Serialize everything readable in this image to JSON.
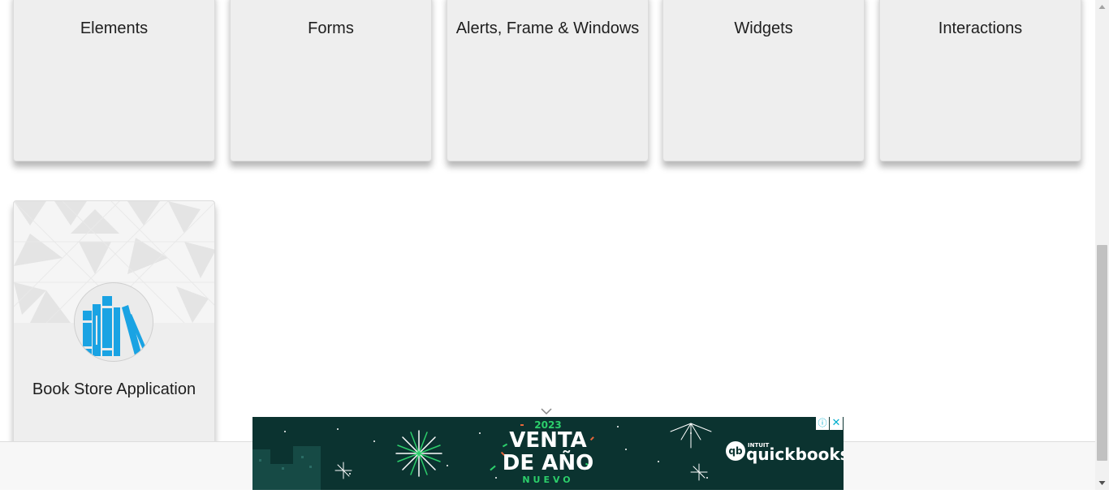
{
  "category_cards": [
    {
      "title": "Elements"
    },
    {
      "title": "Forms"
    },
    {
      "title": "Alerts, Frame & Windows"
    },
    {
      "title": "Widgets"
    },
    {
      "title": "Interactions"
    }
  ],
  "book_store_card": {
    "title": "Book Store Application",
    "icon": "books-icon"
  },
  "advertisement": {
    "year": "2023",
    "headline_line1": "VENTA",
    "headline_line2": "DE AÑO",
    "headline_line3": "NUEVO",
    "brand_small": "INTUIT",
    "brand": "quickbooks",
    "brand_badge": "qb",
    "info_glyph": "ⓘ",
    "close_glyph": "✕"
  },
  "colors": {
    "card_background": "#eeeeee",
    "icon_blue": "#1aa3e3",
    "ad_background": "#0b3330",
    "ad_accent": "#2ccf6b"
  }
}
